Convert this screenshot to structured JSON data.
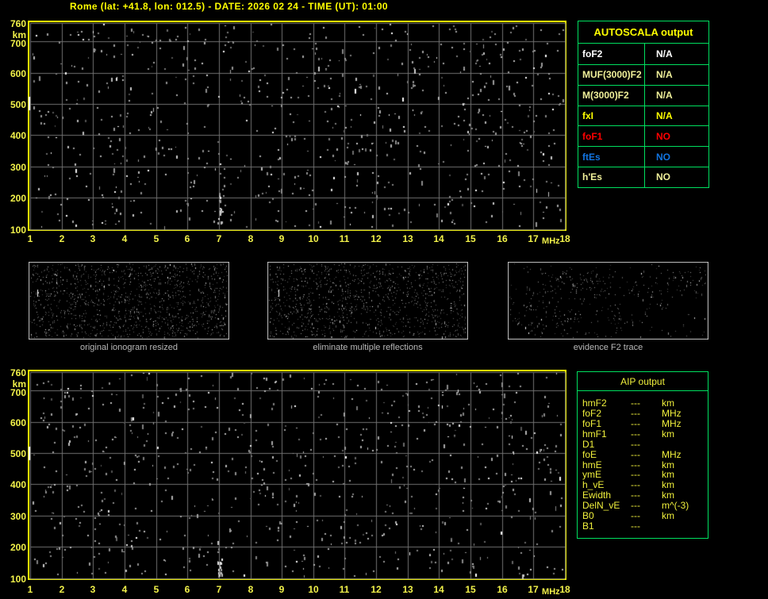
{
  "title": {
    "text": "Rome (lat: +41.8, lon: 012.5) - DATE: 2026 02 24 - TIME (UT): 01:00",
    "color": "#ffff00"
  },
  "colors": {
    "background": "#000000",
    "plot_frame_yellow": "#f2f200",
    "grid_gray": "#717171",
    "axis_label_yellow": "#f2f24a",
    "table_border_green": "#00df5f",
    "panel_border_gray": "#c9c9c9",
    "panel_label_gray": "#b9b9b9",
    "white": "#ffffff",
    "pale_yellow": "#efef99",
    "bright_yellow": "#ffff00",
    "red": "#ff0000",
    "blue": "#1274e0",
    "aip_yellow": "#f0f03c"
  },
  "autoscala_table": {
    "title": "AUTOSCALA output",
    "title_color": "#ffff00",
    "rows": [
      {
        "label": "foF2",
        "value": "N/A",
        "color": "#ffffff"
      },
      {
        "label": "MUF(3000)F2",
        "value": "N/A",
        "color": "#efef99"
      },
      {
        "label": "M(3000)F2",
        "value": "N/A",
        "color": "#efef99"
      },
      {
        "label": "fxI",
        "value": "N/A",
        "color": "#ffff00"
      },
      {
        "label": "foF1",
        "value": "NO",
        "color": "#ff0000"
      },
      {
        "label": "ftEs",
        "value": "NO",
        "color": "#1274e0"
      },
      {
        "label": "h'Es",
        "value": "NO",
        "color": "#efef99"
      }
    ]
  },
  "aip_table": {
    "title": "AIP output",
    "color": "#f0f03c",
    "rows": [
      {
        "param": "hmF2",
        "value": "---",
        "unit": "km"
      },
      {
        "param": "foF2",
        "value": "---",
        "unit": "MHz"
      },
      {
        "param": "foF1",
        "value": "---",
        "unit": "MHz"
      },
      {
        "param": "hmF1",
        "value": "---",
        "unit": "km"
      },
      {
        "param": "D1",
        "value": "---",
        "unit": ""
      },
      {
        "param": "foE",
        "value": "---",
        "unit": "MHz"
      },
      {
        "param": "hmE",
        "value": "---",
        "unit": "km"
      },
      {
        "param": "ymE",
        "value": "---",
        "unit": "km"
      },
      {
        "param": "h_vE",
        "value": "---",
        "unit": "km"
      },
      {
        "param": "Ewidth",
        "value": "---",
        "unit": "km"
      },
      {
        "param": "DelN_vE",
        "value": "---",
        "unit": "m^(-3)"
      },
      {
        "param": "B0",
        "value": "---",
        "unit": "km"
      },
      {
        "param": "B1",
        "value": "---",
        "unit": ""
      }
    ]
  },
  "chart_data": [
    {
      "id": "ionogram_top",
      "type": "scatter",
      "title": "",
      "xlabel": "MHz",
      "ylabel": "km",
      "xlim": [
        1,
        18
      ],
      "ylim": [
        100,
        760
      ],
      "x_ticks": [
        1,
        2,
        3,
        4,
        5,
        6,
        7,
        8,
        9,
        10,
        11,
        12,
        13,
        14,
        15,
        16,
        17,
        18
      ],
      "y_ticks": [
        760,
        700,
        600,
        500,
        400,
        300,
        200,
        100
      ],
      "grid": true,
      "legend": false,
      "description": "ionogram echoes: uniform random noise, no scaled trace (all parameters N/A)",
      "noise": {
        "seed": 20260224,
        "count": 790,
        "dot_w": 2,
        "bright_fraction": 0.06
      },
      "artifact_bar": {
        "x_mhz": 1.0,
        "km_center": 500,
        "km_span": 44
      },
      "clusters": [
        {
          "x_mhz": 7.0,
          "km_lo": 100,
          "km_hi": 210,
          "count": 16
        }
      ]
    },
    {
      "id": "original_ionogram_resized",
      "type": "scatter",
      "label": "original ionogram resized",
      "description": "thumbnail of raw ionogram, dense 1px noise",
      "noise": {
        "seed": 101,
        "count": 1250,
        "dot_w": 1,
        "bright_fraction": 0.025
      },
      "artifact_bar": {
        "fx": 0.045,
        "fy": 0.4,
        "h": 9
      }
    },
    {
      "id": "eliminate_multiple_reflections",
      "type": "scatter",
      "label": "eliminate multiple reflections",
      "description": "thumbnail after multiple-reflection removal, dense 1px noise",
      "noise": {
        "seed": 202,
        "count": 1150,
        "dot_w": 1,
        "bright_fraction": 0.03
      },
      "artifact_bar": {
        "fx": 0.055,
        "fy": 0.4,
        "h": 9
      }
    },
    {
      "id": "evidence_F2_trace",
      "type": "scatter",
      "label": "evidence F2 trace",
      "description": "thumbnail of F2-trace evidence, sparse clustered 1px noise",
      "noise": {
        "seed": 303,
        "count": 430,
        "dot_w": 1,
        "bright_fraction": 0.03
      },
      "cluster_centers": [
        [
          0.17,
          0.45
        ],
        [
          0.28,
          0.72
        ],
        [
          0.1,
          0.78
        ],
        [
          0.42,
          0.3
        ],
        [
          0.25,
          0.25
        ],
        [
          0.7,
          0.4
        ],
        [
          0.55,
          0.75
        ],
        [
          0.88,
          0.25
        ]
      ]
    },
    {
      "id": "ionogram_bottom",
      "type": "scatter",
      "title": "",
      "xlabel": "MHz",
      "ylabel": "km",
      "xlim": [
        1,
        18
      ],
      "ylim": [
        100,
        760
      ],
      "x_ticks": [
        1,
        2,
        3,
        4,
        5,
        6,
        7,
        8,
        9,
        10,
        11,
        12,
        13,
        14,
        15,
        16,
        17,
        18
      ],
      "y_ticks": [
        760,
        700,
        600,
        500,
        400,
        300,
        200,
        100
      ],
      "grid": true,
      "legend": false,
      "description": "ionogram echoes: uniform random noise, no scaled trace (all AIP parameters ---)",
      "noise": {
        "seed": 9151622,
        "count": 790,
        "dot_w": 2,
        "bright_fraction": 0.06
      },
      "artifact_bar": {
        "x_mhz": 1.0,
        "km_center": 500,
        "km_span": 42
      },
      "clusters": [
        {
          "x_mhz": 7.0,
          "km_lo": 100,
          "km_hi": 210,
          "count": 18
        }
      ]
    }
  ]
}
